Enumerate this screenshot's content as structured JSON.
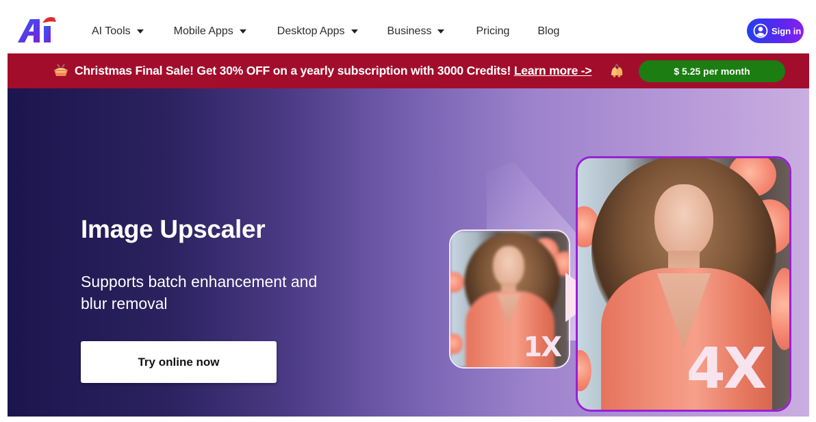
{
  "header": {
    "logo_alt": "AI",
    "nav": [
      {
        "label": "AI Tools",
        "has_dropdown": true
      },
      {
        "label": "Mobile Apps",
        "has_dropdown": true
      },
      {
        "label": "Desktop Apps",
        "has_dropdown": true
      },
      {
        "label": "Business",
        "has_dropdown": true
      },
      {
        "label": "Pricing",
        "has_dropdown": false
      },
      {
        "label": "Blog",
        "has_dropdown": false
      }
    ],
    "signin_label": "Sign in",
    "signin_icon": "user-circle-icon"
  },
  "promo": {
    "left_icon": "christmas-pie-icon",
    "text": "Christmas Final Sale! Get 30% OFF on a yearly subscription with 3000 Credits! ",
    "link_label": "Learn more ->",
    "right_icon": "christmas-bells-icon",
    "button_label": "$ 5.25 per month",
    "colors": {
      "banner": "#a30d2c",
      "button": "#1b7d12"
    }
  },
  "hero": {
    "title": "Image Upscaler",
    "subtitle": "Supports batch enhancement and blur removal",
    "cta_label": "Try online now",
    "before_label": "1X",
    "after_label": "4X",
    "accent_color": "#9a1fd6"
  }
}
